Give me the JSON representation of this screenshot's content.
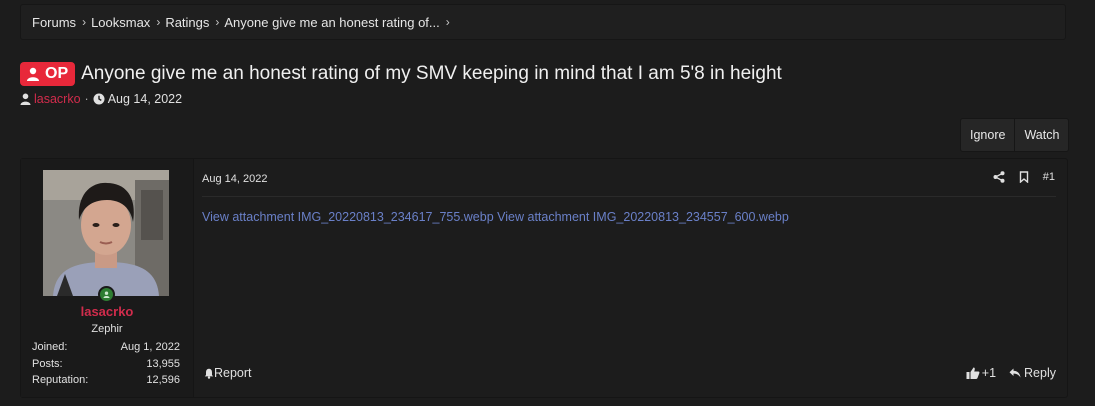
{
  "breadcrumb": [
    "Forums",
    "Looksmax",
    "Ratings",
    "Anyone give me an honest rating of..."
  ],
  "thread": {
    "badge": "OP",
    "title": "Anyone give me an honest rating of my SMV keeping in mind that I am 5'8 in height",
    "author": "lasacrko",
    "date": "Aug 14, 2022"
  },
  "actions": {
    "ignore": "Ignore",
    "watch": "Watch"
  },
  "user": {
    "name": "lasacrko",
    "title": "Zephir",
    "joined_label": "Joined:",
    "joined": "Aug 1, 2022",
    "posts_label": "Posts:",
    "posts": "13,955",
    "rep_label": "Reputation:",
    "reputation": "12,596"
  },
  "post": {
    "date": "Aug 14, 2022",
    "number": "#1",
    "attachments": [
      "View attachment IMG_20220813_234617_755.webp",
      "View attachment IMG_20220813_234557_600.webp"
    ],
    "report": "Report",
    "like_count": "+1",
    "reply": "Reply"
  },
  "colors": {
    "accent": "#d12c4c",
    "op_badge": "#e8283a",
    "link": "#6a80c8"
  },
  "icons": [
    "user-icon",
    "clock-icon",
    "share-icon",
    "bookmark-icon",
    "bell-icon",
    "thumbs-up-icon",
    "reply-icon",
    "online-status-icon"
  ]
}
